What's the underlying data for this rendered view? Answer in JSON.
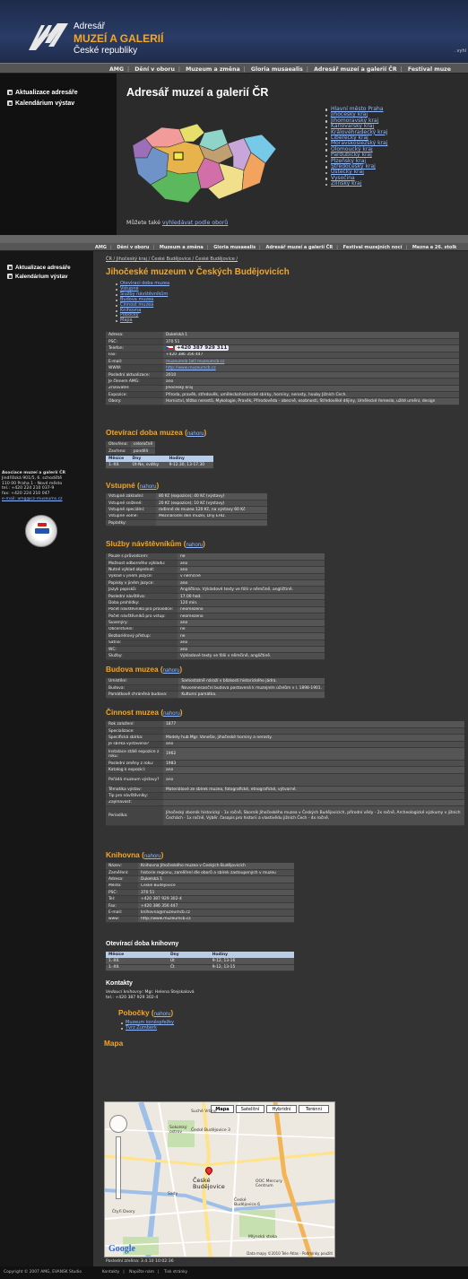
{
  "header": {
    "logo_sub1": "Adresář",
    "logo_title": "MUZEÍ A GALERIÍ",
    "logo_sub2": "České republiky",
    "search_hint": ". vyhl"
  },
  "nav": {
    "items": [
      "AMG",
      "Dění v oboru",
      "Muzeum a změna",
      "Gloria musaealis",
      "Adresář muzeí a galerií ČR",
      "Festival muze"
    ],
    "items2": [
      "AMG",
      "Dění v oboru",
      "Muzeum a změna",
      "Gloria musaealis",
      "Adresář muzeí a galerií ČR",
      "Festival muzejních nocí",
      "Mezna a 26. stolk"
    ]
  },
  "sidebar": {
    "items": [
      "Aktualizace adresáře",
      "Kalendárium výstav"
    ]
  },
  "directory": {
    "title": "Adresář muzeí a galerií ČR",
    "regions": [
      "Hlavní město Praha",
      "Jihočeský kraj",
      "Jihomoravský kraj",
      "Karlovarský kraj",
      "Královéhradecký kraj",
      "Liberecký kraj",
      "Moravskoslezský kraj",
      "Olomoucký kraj",
      "Pardubický kraj",
      "Plzeňský kraj",
      "Středočeský kraj",
      "Ústecký kraj",
      "Vysočina",
      "Zlínský kraj"
    ],
    "obory_prefix": "Můžete také ",
    "obory_link": "vyhledávat podle oborů"
  },
  "association": {
    "lines": [
      "Asociace muzeí a galerií ČR",
      "Jindřišská 901/5, 6. schodiště",
      "110 00 Praha 1 - Nové město",
      "tel.: +420 224 210 037-9",
      "fax: +420 224 210 047",
      "e-mail: amg@cz-museums.cz"
    ]
  },
  "breadcrumb": "ČR / Jihočeský kraj / České Budějovice / České Budějovice /",
  "museum": {
    "title": "Jihočeské muzeum v Českých Budějovicích",
    "toc": [
      "Otevírací doba muzea",
      "Vstupné",
      "Služby návštěvníkům",
      "Budova muzea",
      "Činnost muzea",
      "Knihovna",
      "Pobočky",
      "Mapa"
    ],
    "info": [
      [
        "Adresa:",
        "Dukelská 1"
      ],
      [
        "PSČ:",
        "370 51"
      ],
      [
        "Telefon:",
        "+420 387 929 311"
      ],
      [
        "Fax:",
        "+420 386 356 447"
      ],
      [
        "E-mail:",
        "muzeumcb [at] muzeumcb.cz"
      ],
      [
        "WWW:",
        "http://www.muzeumcb.cz"
      ],
      [
        "Poslední aktualizace:",
        "2010"
      ],
      [
        "Je členem AMG:",
        "ano"
      ],
      [
        "Zřizovatel:",
        "Jihočeský kraj"
      ],
      [
        "Expozice:",
        "Příroda, pravěk, středověk, uměleckohistorické sbírky, horniny, nerosty, houby Jižních Čech."
      ],
      [
        "Obory:",
        "Hornictví, těžba nerostů, Mykologie, Pravěk, Přírodověda - obecně, osobnosti, Středověké dějiny, Umělecké řemeslo, užité umění, design"
      ]
    ]
  },
  "sections": {
    "up_label": "nahoru",
    "opening": "Otevírací doba muzea",
    "admission": "Vstupné",
    "services": "Služby návštěvníkům",
    "building": "Budova muzea",
    "activity": "Činnost muzea",
    "library": "Knihovna",
    "branches": "Pobočky",
    "map": "Mapa"
  },
  "opening": {
    "rows": [
      [
        "Otevřeno:",
        "celoročně"
      ],
      [
        "Zavřeno:",
        "pondělí"
      ]
    ],
    "headers": [
      "Měsíce",
      "Dny",
      "Hodiny"
    ],
    "hours": [
      [
        "1.-XII.",
        "Út-Ne, svátky",
        "9-12.30, 13-17.30"
      ]
    ]
  },
  "admission": [
    [
      "Vstupné základní:",
      "80 Kč (expozice); 40 Kč (výstavy)"
    ],
    [
      "Vstupné snížené:",
      "20 Kč (expozice); 10 Kč (výstavy)"
    ],
    [
      "Vstupné speciální:",
      "rodinné do muzea 120 Kč, na výstavy 60 Kč"
    ],
    [
      "Vstupné volné:",
      "Mezinárodní den muzeí, Dny EHD."
    ],
    [
      "Poplatky:",
      ""
    ]
  ],
  "services": [
    [
      "Pouze s průvodcem:",
      "ne"
    ],
    [
      "Možnost odborného výkladu:",
      "ano"
    ],
    [
      "Nutné výklad objednat:",
      "ano"
    ],
    [
      "Výklad v jiném jazyce:",
      "v němčině"
    ],
    [
      "Popisky v jiném jazyce:",
      "ano"
    ],
    [
      "Jazyk popisků:",
      "Angličtina. Výkladové texty ve fólii v němčině, angličtině."
    ],
    [
      "Poslední návštěva:",
      "17.00 hod."
    ],
    [
      "Doba prohlídky:",
      "120 min."
    ],
    [
      "Počet návštěvníků pro průvodce:",
      "neomezeno"
    ],
    [
      "Počet návštěvníků pro vstup:",
      "neomezeno"
    ],
    [
      "Suvenýry:",
      "ano"
    ],
    [
      "Občerstvení:",
      "ne"
    ],
    [
      "Bezbariérový přístup:",
      "ne"
    ],
    [
      "Šatna:",
      "ano"
    ],
    [
      "WC:",
      "ano"
    ],
    [
      "Služby:",
      "Výkladové texty ve fólii v němčině, angličtině."
    ]
  ],
  "building": [
    [
      "Umístění:",
      "Samostatně nároží v blízkosti historického jádra."
    ],
    [
      "Budova:",
      "Novorenesanční budova postavená k muzejním účelům v l. 1898-1901."
    ],
    [
      "Památkově chráněná budova:",
      "Kulturní památka."
    ]
  ],
  "activity": [
    [
      "Rok založení:",
      "1877"
    ],
    [
      "Specializace:",
      ""
    ],
    [
      "Specifická sbírka:",
      "Modely hub Mgr. Vonešie, jihočeské horniny a nerosty."
    ],
    [
      "Je sbírka vystavena?",
      "ano"
    ],
    [
      "Instalace stálé expozice z roku:",
      "1962"
    ],
    [
      "Poslední změny z roku:",
      "1983"
    ],
    [
      "Katalog k expozici:",
      "ano"
    ],
    [
      "Pořádá muzeum výstavy?",
      "ano"
    ],
    [
      "Tématika výstav:",
      "Materiálové ze sbírek muzea, fotografické, etnografické, výtvarné."
    ],
    [
      "Tip pro návštěvníky:",
      ""
    ],
    [
      "Zajímavost:",
      ""
    ],
    [
      "Periodika:",
      "Jihočeský sborník historický - 1x ročně, Sborník Jihočeského muzea v Českých Budějovicích, přírodní vědy - 2x ročně, Archeologické výzkumy v jižních Čechách - 1x ročně, Výběr. časopis pro historii a vlastivědu jižních Čech - 4x ročně."
    ]
  ],
  "library": {
    "rows": [
      [
        "Název:",
        "Knihovna Jihočeského muzea v Českých Budějovicích"
      ],
      [
        "Zaměření:",
        "historie regionu, zaměření dle oborů a sbírek zastoupených v muzeu"
      ],
      [
        "Adresa:",
        "Dukelská 1"
      ],
      [
        "Město:",
        "České Budějovice"
      ],
      [
        "PSČ:",
        "370 51"
      ],
      [
        "Tel:",
        "+420 387 929 302-4"
      ],
      [
        "Fax:",
        "+420 386 356 447"
      ],
      [
        "E-mail:",
        "knihovna@muzeumcb.cz"
      ],
      [
        "www:",
        "http://www.muzeumcb.cz"
      ]
    ],
    "hours_title": "Otevírací doba knihovny",
    "headers": [
      "Měsíce",
      "Dny",
      "Hodiny"
    ],
    "hours": [
      [
        "1.-XII.",
        "Út",
        "9-12, 13-16"
      ],
      [
        "1.-XII.",
        "Čt",
        "9-12, 13-15"
      ]
    ],
    "contacts_title": "Kontakty",
    "contact_role": "Vedoucí knihovny:",
    "contact_name": "Mgr. Helena Stejskalová",
    "contact_tel": "tel.: +420 387 929 302-4"
  },
  "branches": [
    "Muzeum koněspřežky",
    "Tvrz Žumberk"
  ],
  "map": {
    "types": [
      "Mapa",
      "Satelitní",
      "Hybridní",
      "Terénní"
    ],
    "labels": {
      "city": "České Budějovice",
      "district3": "České Budějovice 3",
      "district6": "České Budějovice 6",
      "north": "Suché Vrbné",
      "east": "OOC Mercury Centrum",
      "west": "Čtyři Dvory",
      "south": "Mlýnská stoka",
      "island": "Sokolský ostrov",
      "park": "Sady",
      "logo": "Google",
      "attribution": "Data mapy ©2010 Tele Atlas - Podmínky použití"
    },
    "last_change": "Poslední změna: 3.4.10 10:02:36"
  },
  "footer": {
    "copyright": "Copyright © 2007 AMG, EVANSK Studio",
    "links": [
      "Kontakty",
      "Napište nám",
      "Tisk stránky"
    ]
  },
  "colors": {
    "accent": "#f5a623",
    "link": "#8fb8ff",
    "header": "#2a3c66"
  }
}
